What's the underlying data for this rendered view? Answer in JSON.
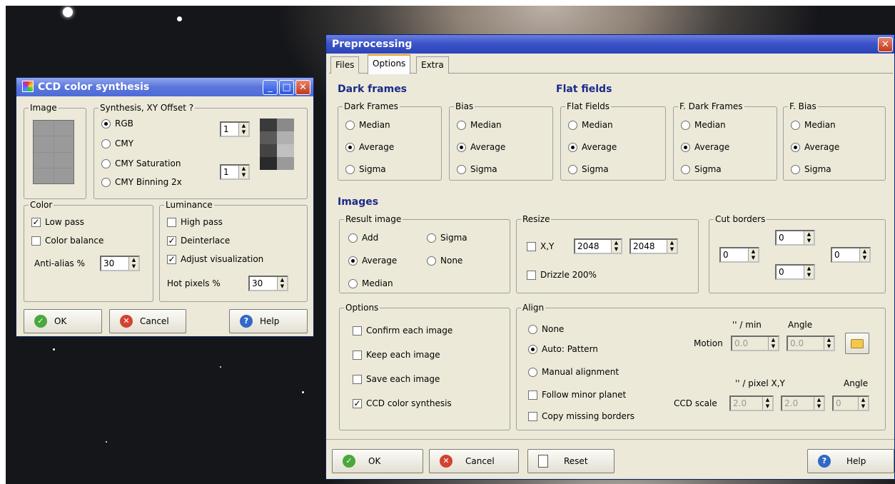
{
  "ccd": {
    "title": "CCD color synthesis",
    "image_group": "Image",
    "synthesis_group": "Synthesis, XY Offset ?",
    "synthesis_options": [
      "RGB",
      "CMY",
      "CMY Saturation",
      "CMY Binning 2x"
    ],
    "synthesis_selected": "RGB",
    "offset_x": "1",
    "offset_y": "1",
    "color_group": "Color",
    "color_low_pass": "Low pass",
    "color_low_pass_checked": true,
    "color_balance": "Color balance",
    "color_balance_checked": false,
    "anti_alias_label": "Anti-alias %",
    "anti_alias_value": "30",
    "luminance_group": "Luminance",
    "lum_high_pass": "High pass",
    "lum_high_pass_checked": false,
    "lum_deinterlace": "Deinterlace",
    "lum_deinterlace_checked": true,
    "lum_adjust": "Adjust visualization",
    "lum_adjust_checked": true,
    "hot_pixels_label": "Hot pixels %",
    "hot_pixels_value": "30",
    "ok": "OK",
    "cancel": "Cancel",
    "help": "Help"
  },
  "pre": {
    "title": "Preprocessing",
    "tabs": [
      "Files",
      "Options",
      "Extra"
    ],
    "active_tab": "Options",
    "dark_frames_heading": "Dark frames",
    "flat_fields_heading": "Flat fields",
    "images_heading": "Images",
    "method_groups": [
      {
        "label": "Dark Frames",
        "selected": "Average"
      },
      {
        "label": "Bias",
        "selected": "Average"
      },
      {
        "label": "Flat Fields",
        "selected": "Average"
      },
      {
        "label": "F. Dark Frames",
        "selected": "Average"
      },
      {
        "label": "F. Bias",
        "selected": "Average"
      }
    ],
    "methods": [
      "Median",
      "Average",
      "Sigma"
    ],
    "result_group": "Result image",
    "result_options": {
      "add": "Add",
      "average": "Average",
      "median": "Median",
      "sigma": "Sigma",
      "none": "None"
    },
    "result_selected": "Average",
    "resize_group": "Resize",
    "resize_xy_label": "X,Y",
    "resize_x": "2048",
    "resize_y": "2048",
    "drizzle": "Drizzle 200%",
    "cut_group": "Cut borders",
    "cut_top": "0",
    "cut_left": "0",
    "cut_right": "0",
    "cut_bottom": "0",
    "options_group": "Options",
    "option_items": [
      {
        "label": "Confirm each image",
        "checked": false
      },
      {
        "label": "Keep each image",
        "checked": false
      },
      {
        "label": "Save each image",
        "checked": false
      },
      {
        "label": "CCD color synthesis",
        "checked": true
      }
    ],
    "align_group": "Align",
    "align_options": [
      "None",
      "Auto: Pattern",
      "Manual alignment"
    ],
    "align_selected": "Auto: Pattern",
    "follow_minor": "Follow minor planet",
    "copy_borders": "Copy missing borders",
    "motion_hdr_rate": "'' / min",
    "motion_hdr_angle": "Angle",
    "motion_label": "Motion",
    "motion_rate": "0.0",
    "motion_angle": "0.0",
    "scale_hdr_pixel": "'' / pixel  X,Y",
    "scale_hdr_angle": "Angle",
    "scale_label": "CCD scale",
    "scale_x": "2.0",
    "scale_y": "2.0",
    "scale_angle": "0",
    "ok": "OK",
    "cancel": "Cancel",
    "reset": "Reset",
    "help": "Help"
  },
  "colors": {
    "title_active": "#3b54c9",
    "face": "#ece9d8",
    "heading": "#1a2a8a"
  }
}
